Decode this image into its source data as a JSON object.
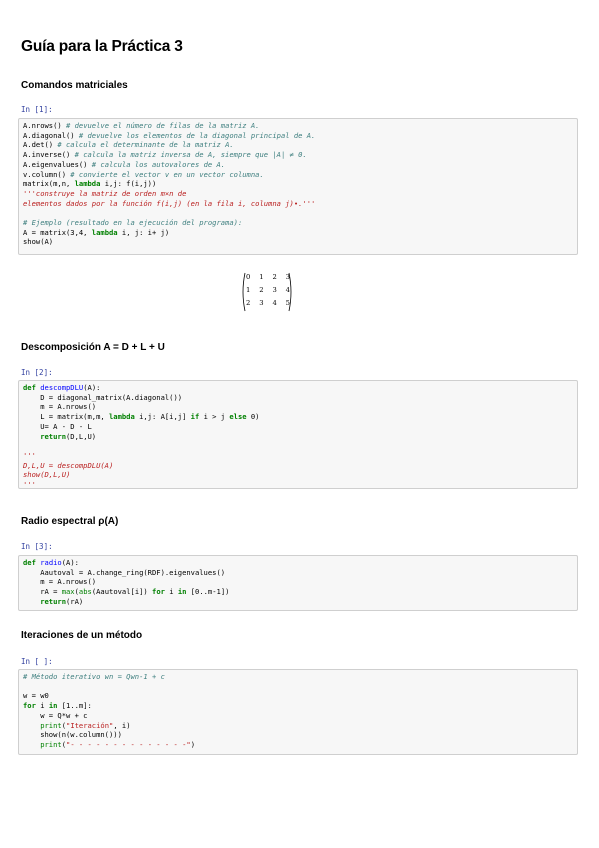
{
  "title": "Guía para la Práctica 3",
  "sections": [
    {
      "heading": "Comandos matriciales",
      "prompt": "In [1]:"
    },
    {
      "heading": "Descomposición A = D + L + U",
      "prompt": "In [2]:"
    },
    {
      "heading": "Radio espectral ρ(A)",
      "prompt": "In [3]:"
    },
    {
      "heading": "Iteraciones de un método",
      "prompt": "In [ ]:"
    }
  ],
  "cell1": {
    "l1": [
      "A.nrows() ",
      "# devuelve el número de filas de la matriz A."
    ],
    "l2": [
      "A.diagonal() ",
      "# devuelve los elementos de la diagonal principal de A."
    ],
    "l3": [
      "A.det() ",
      "# calcula el determinante de la matriz A."
    ],
    "l4": [
      "A.inverse() ",
      "# calcula la matriz inversa de A, siempre que |A| ≠ 0."
    ],
    "l5": [
      "A.eigenvalues() ",
      "# calcula los autovalores de A."
    ],
    "l6": [
      "v.column() ",
      "# convierte el vector v en un vector columna."
    ],
    "l7": [
      "matrix(m,n, ",
      "lambda",
      " i,j: f(i,j))"
    ],
    "l8": "'''construye la matriz de orden m×n de",
    "l9": "elementos dados por la función f(i,j) (en la fila i, columna j)•.'''",
    "l10": "# Ejemplo (resultado en la ejecución del programa):",
    "l11": [
      "A = matrix(3,4, ",
      "lambda",
      " i, j: i+ j)"
    ],
    "l12": "show(A)"
  },
  "output_matrix": [
    [
      "0",
      "1",
      "2",
      "3"
    ],
    [
      "1",
      "2",
      "3",
      "4"
    ],
    [
      "2",
      "3",
      "4",
      "5"
    ]
  ],
  "cell2": {
    "def": "def",
    "fname": "descompDLU",
    "sig": "(A):",
    "l2": "    D = diagonal_matrix(A.diagonal())",
    "l3": "    m = A.nrows()",
    "l4a": "    L = matrix(m,m, ",
    "lambda": "lambda",
    "l4b": " i,j: A[i,j] ",
    "if": "if",
    "l4c": " i > j ",
    "else": "else",
    "l4d": " 0)",
    "l5": "    U= A - D - L",
    "ret": "return",
    "l6": "(D,L,U)",
    "q1": "'''",
    "s1": "D,L,U = descompDLU(A)",
    "s2": "show(D,L,U)",
    "q2": "'''"
  },
  "cell3": {
    "def": "def",
    "fname": "radio",
    "sig": "(A):",
    "l2": "    Aautoval = A.change_ring(RDF).eigenvalues()",
    "l3": "    m = A.nrows()",
    "l4a": "    rA = ",
    "max": "max",
    "l4b": "(",
    "abs": "abs",
    "l4c": "(Aautoval[i]) ",
    "for": "for",
    "l4d": " i ",
    "in": "in",
    "l4e": " [0..m-1])",
    "ret": "return",
    "l5": "(rA)"
  },
  "cell4": {
    "c1": "# Método iterativo wn = Qwn-1 + c",
    "l2": "w = w0",
    "for": "for",
    "l3a": " i ",
    "in": "in",
    "l3b": " [1..m]:",
    "l4": "    w = Q*w + c",
    "print": "print",
    "l5a": "(",
    "s5": "\"Iteración\"",
    "l5b": ", i)",
    "l6": "    show(n(w.column()))",
    "s7": "\"- - - - - - - - - - - - - -\"",
    "l7b": ")"
  }
}
